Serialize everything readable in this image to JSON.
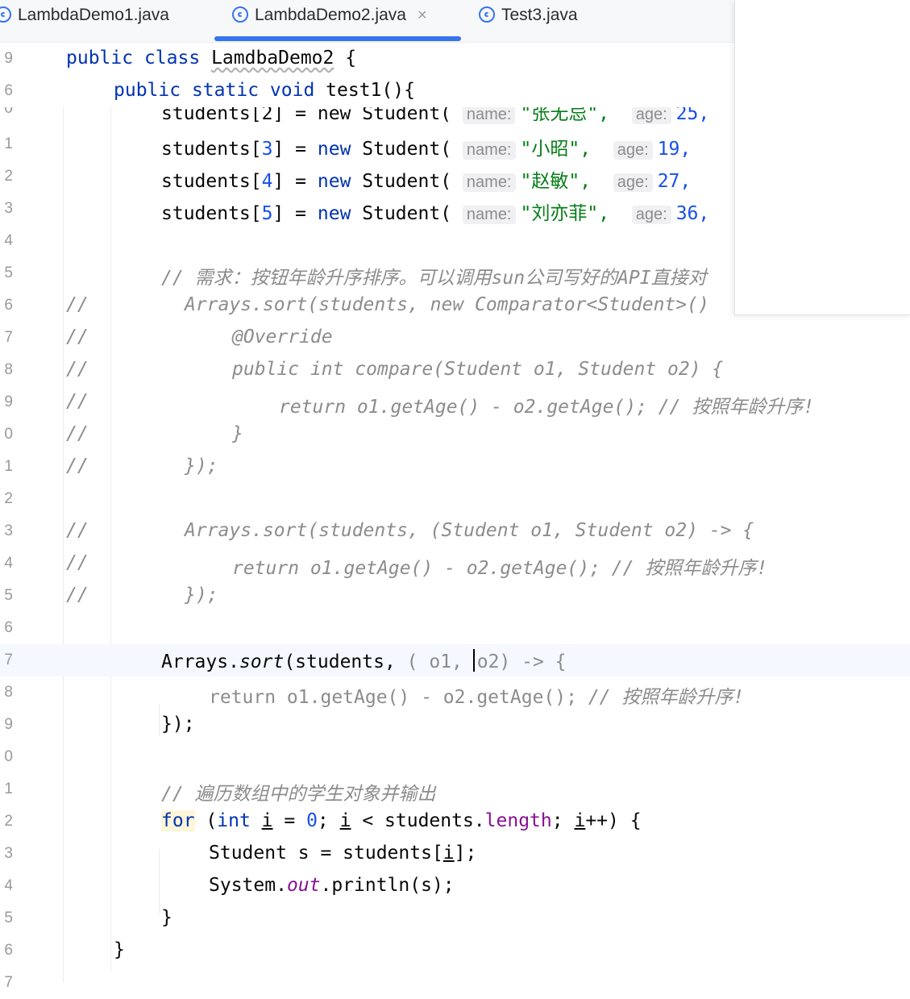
{
  "tabs": [
    {
      "label": "LambdaDemo1.java",
      "active": false
    },
    {
      "label": "LambdaDemo2.java",
      "active": true,
      "close": "×"
    },
    {
      "label": "Test3.java",
      "active": false
    }
  ],
  "sticky_lines": [
    {
      "num": "9",
      "text": "public class LamdbaDemo2 {"
    },
    {
      "num": "6",
      "text": "public static void test1(){"
    }
  ],
  "lines": {
    "l20": {
      "num": "0",
      "code": "students[2] = new Student(",
      "hint_name": "name:",
      "str": "\"张无忌\",",
      "hint_age": "age:",
      "age": "25,"
    },
    "l21": {
      "num": "1",
      "code": "students[3] = new Student(",
      "hint_name": "name:",
      "str": "\"小昭\",",
      "hint_age": "age:",
      "age": "19,"
    },
    "l22": {
      "num": "2",
      "code": "students[4] = new Student(",
      "hint_name": "name:",
      "str": "\"赵敏\",",
      "hint_age": "age:",
      "age": "27,"
    },
    "l23": {
      "num": "3",
      "code": "students[5] = new Student(",
      "hint_name": "name:",
      "str": "\"刘亦菲\",",
      "hint_age": "age:",
      "age": "36,"
    },
    "l24": {
      "num": "4"
    },
    "l25": {
      "num": "5",
      "cmt": "// 需求：按钮年龄升序排序。可以调用sun公司写好的API直接对"
    },
    "l26": {
      "num": "6",
      "prefix": "//",
      "cmt": "Arrays.sort(students, new Comparator<Student>()"
    },
    "l27": {
      "num": "7",
      "prefix": "//",
      "cmt": "@Override"
    },
    "l28": {
      "num": "8",
      "prefix": "//",
      "cmt": "public int compare(Student o1, Student o2) {"
    },
    "l29": {
      "num": "9",
      "prefix": "//",
      "cmt": "return o1.getAge() - o2.getAge(); // 按照年龄升序!"
    },
    "l30": {
      "num": "0",
      "prefix": "//",
      "cmt": "}"
    },
    "l31": {
      "num": "1",
      "prefix": "//",
      "cmt": "});"
    },
    "l32": {
      "num": "2"
    },
    "l33": {
      "num": "3",
      "prefix": "//",
      "cmt": "Arrays.sort(students, (Student o1, Student o2) -> {"
    },
    "l34": {
      "num": "4",
      "prefix": "//",
      "cmt": "return o1.getAge() - o2.getAge(); // 按照年龄升序!"
    },
    "l35": {
      "num": "5",
      "prefix": "//",
      "cmt": "});"
    },
    "l36": {
      "num": "6"
    },
    "l37": {
      "num": "7",
      "a": "Arrays.",
      "sort": "sort",
      "b": "(students, ",
      "p1": "( o1, ",
      "p2": "o2) -> {"
    },
    "l38": {
      "num": "8",
      "code": "return o1.getAge() - o2.getAge(); ",
      "cmt": "// 按照年龄升序!"
    },
    "l39": {
      "num": "9",
      "code": "});"
    },
    "l40": {
      "num": "0"
    },
    "l41": {
      "num": "1",
      "cmt": "// 遍历数组中的学生对象并输出"
    },
    "l42": {
      "num": "2",
      "kw_for": "for",
      "p_open": " (",
      "kw_int": "int",
      "var_i": "i",
      "eq": " = ",
      "zero": "0",
      "semi": "; ",
      "lt": " < students.",
      "length": "length",
      "semi2": "; ",
      "inc": "++) {"
    },
    "l43": {
      "num": "3",
      "code_a": "Student s = students[",
      "idx": "i",
      "code_b": "];"
    },
    "l44": {
      "num": "4",
      "code_a": "System.",
      "out": "out",
      "code_b": ".println(s);"
    },
    "l45": {
      "num": "5",
      "code": "}"
    },
    "l46": {
      "num": "6",
      "code": "}"
    },
    "l47": {
      "num": "7"
    }
  },
  "keywords": {
    "new": "new",
    "public": "public",
    "class": "class",
    "static": "static",
    "void": "void"
  },
  "colors": {
    "keyword": "#0033b3",
    "number": "#1750eb",
    "string": "#067d17",
    "comment": "#8c8c8c",
    "accent": "#3574f0"
  }
}
